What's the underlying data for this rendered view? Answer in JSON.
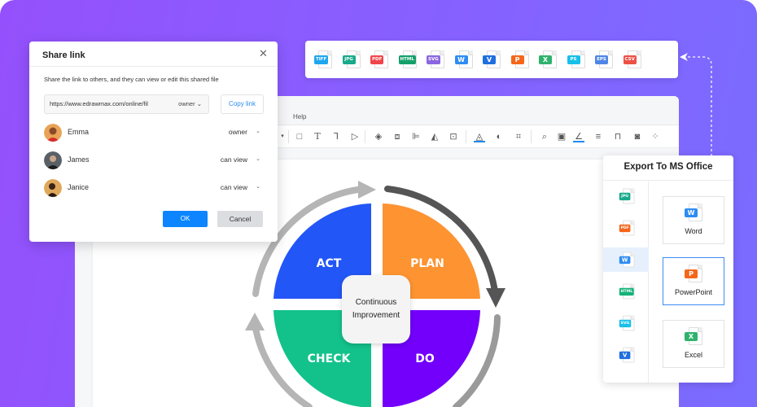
{
  "editor": {
    "menu_help": "Help"
  },
  "share_dialog": {
    "title": "Share link",
    "description": "Share the link to others, and they can view or edit this shared file",
    "link_value": "https://www.edrawmax.com/online/fil",
    "link_role": "owner",
    "copy_label": "Copy link",
    "users": [
      {
        "name": "Emma",
        "role": "owner"
      },
      {
        "name": "James",
        "role": "can view"
      },
      {
        "name": "Janice",
        "role": "can view"
      }
    ],
    "ok_label": "OK",
    "cancel_label": "Cancel"
  },
  "formats_bar": {
    "items": [
      {
        "label": "TIFF",
        "color": "#1fa6f0"
      },
      {
        "label": "JPG",
        "color": "#17a98a"
      },
      {
        "label": "PDF",
        "color": "#f0454b"
      },
      {
        "label": "HTML",
        "color": "#14a06a"
      },
      {
        "label": "SVG",
        "color": "#8a67e0"
      },
      {
        "label": "W",
        "color": "#2e8cf2"
      },
      {
        "label": "V",
        "color": "#1f6fe0"
      },
      {
        "label": "P",
        "color": "#f5661a"
      },
      {
        "label": "X",
        "color": "#2fb26b"
      },
      {
        "label": "PS",
        "color": "#17c0e8"
      },
      {
        "label": "EPS",
        "color": "#4e86e6"
      },
      {
        "label": "CSV",
        "color": "#ec5146"
      }
    ]
  },
  "diagram": {
    "quadrants": [
      {
        "label": "ACT",
        "color": "#2356f6"
      },
      {
        "label": "PLAN",
        "color": "#fd9331"
      },
      {
        "label": "CHECK",
        "color": "#13c28b"
      },
      {
        "label": "DO",
        "color": "#7200fb"
      }
    ],
    "center_line1": "Continuous",
    "center_line2": "Improvement"
  },
  "export_panel": {
    "title": "Export To MS Office",
    "side_items": [
      {
        "label": "JPG",
        "color": "#17a98a"
      },
      {
        "label": "PDF",
        "color": "#f5661a"
      },
      {
        "label": "W",
        "color": "#2e8cf2"
      },
      {
        "label": "HTML",
        "color": "#14b37a"
      },
      {
        "label": "SVG",
        "color": "#17c0e8"
      },
      {
        "label": "V",
        "color": "#1f6fe0"
      }
    ],
    "active_side_index": 2,
    "cards": [
      {
        "label": "Word",
        "tag": "W",
        "color": "#2e8cf2"
      },
      {
        "label": "PowerPoint",
        "tag": "P",
        "color": "#f5661a"
      },
      {
        "label": "Excel",
        "tag": "X",
        "color": "#2fb26b"
      }
    ],
    "selected_card_index": 1
  }
}
